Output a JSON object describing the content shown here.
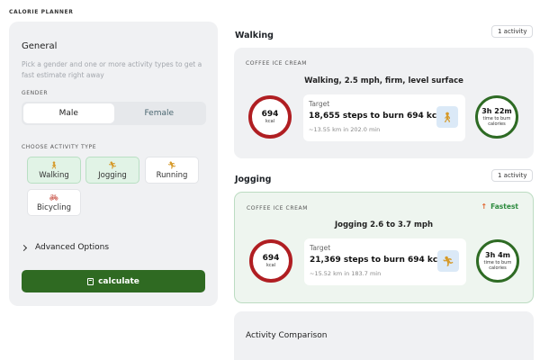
{
  "app": {
    "title": "CALORIE PLANNER"
  },
  "general": {
    "title": "General",
    "description": "Pick a gender and one or more activity types to get a fast estimate right away",
    "gender_label": "GENDER",
    "gender_options": [
      "Male",
      "Female"
    ],
    "selected_gender": "Male",
    "activity_label": "CHOOSE ACTIVITY TYPE",
    "activities": [
      {
        "label": "Walking",
        "icon": "walking-icon",
        "selected": true
      },
      {
        "label": "Jogging",
        "icon": "running-icon",
        "selected": true
      },
      {
        "label": "Running",
        "icon": "running-icon",
        "selected": false
      },
      {
        "label": "Bicycling",
        "icon": "bicycle-icon",
        "selected": false
      }
    ],
    "advanced_label": "Advanced Options",
    "calculate_label": "calculate"
  },
  "results": {
    "walking": {
      "section_title": "Walking",
      "badge": "1 activity",
      "food": "COFFEE ICE CREAM",
      "activity": "Walking, 2.5 mph, firm, level surface",
      "kcal": "694",
      "kcal_unit": "kcal",
      "target_label": "Target",
      "target_steps": "18,655 steps to burn 694 kcal",
      "target_sub": "~13.55 km in 202.0 min",
      "time": "3h 22m",
      "time_sub": "time to burn calories"
    },
    "jogging": {
      "section_title": "Jogging",
      "badge": "1 activity",
      "food": "COFFEE ICE CREAM",
      "fastest": "Fastest",
      "activity": "Jogging 2.6 to 3.7 mph",
      "kcal": "694",
      "kcal_unit": "kcal",
      "target_label": "Target",
      "target_steps": "21,369 steps to burn 694 kcal",
      "target_sub": "~15.52 km in 183.7 min",
      "time": "3h 4m",
      "time_sub": "time to burn calories"
    },
    "comparison": {
      "title": "Activity Comparison"
    }
  },
  "colors": {
    "primary_button": "#2f6a22",
    "kcal_ring": "#b01e22",
    "time_ring": "#2e6b24",
    "selected_chip": "#e1f3e6",
    "fastest": "#2c8a3d"
  }
}
